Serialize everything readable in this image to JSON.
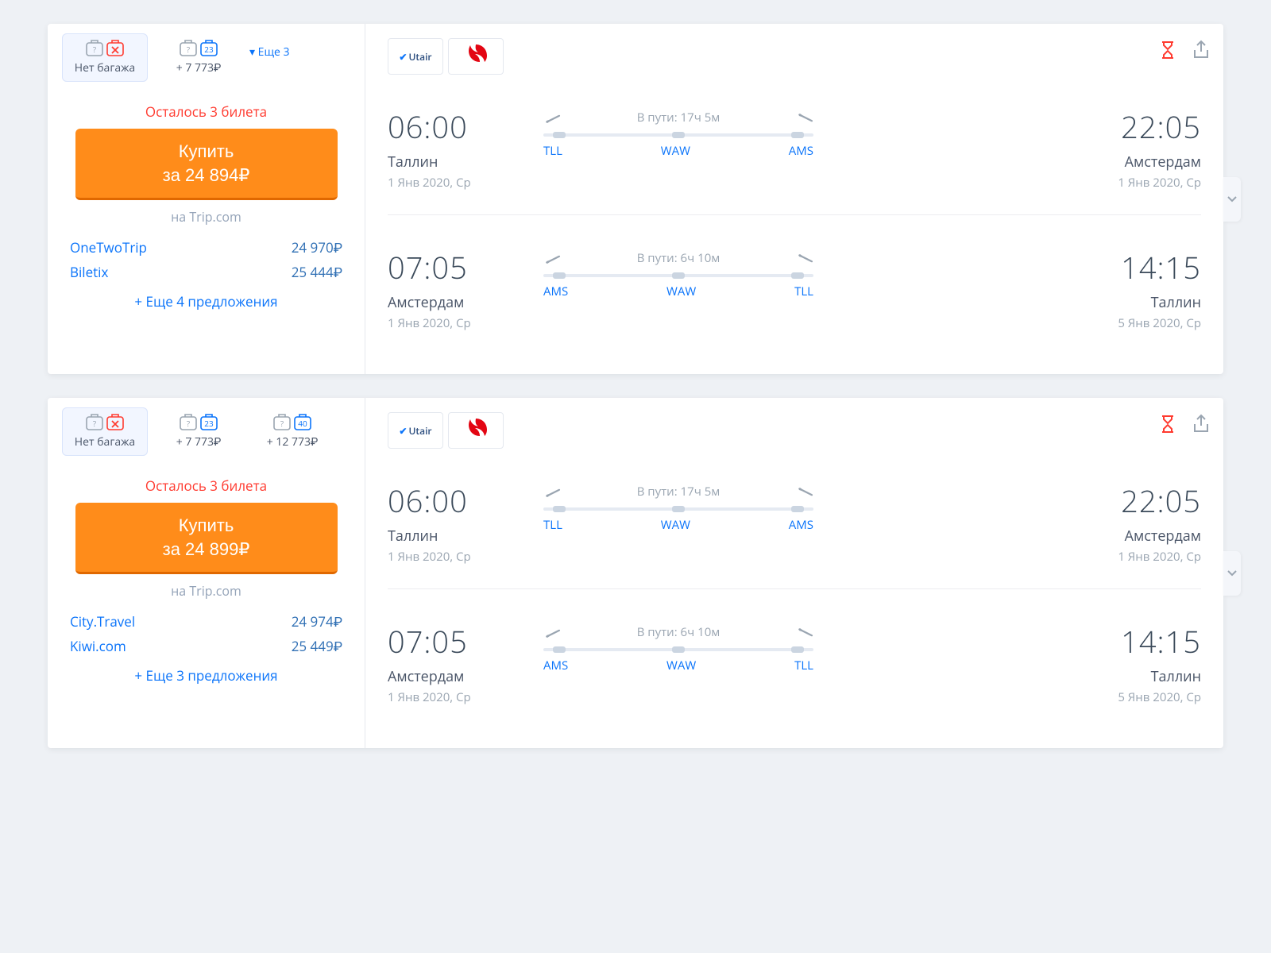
{
  "cards": [
    {
      "baggage": {
        "tabs": [
          {
            "label": "Нет багажа",
            "variant": "none"
          },
          {
            "label": "+ 7 773₽",
            "variant": "kg",
            "kg": "23"
          }
        ],
        "more": "▾ Еще 3"
      },
      "tickets_left": "Осталось 3 билета",
      "buy": {
        "line1": "Купить",
        "line2": "за 24 894₽"
      },
      "buy_on": "на Trip.com",
      "alts": [
        {
          "name": "OneTwoTrip",
          "price": "24 970₽"
        },
        {
          "name": "Biletix",
          "price": "25 444₽"
        }
      ],
      "more_offers": "+ Еще 4 предложения",
      "airlines": [
        "Utair",
        "red-bird"
      ],
      "segments": [
        {
          "dep_time": "06:00",
          "dep_city": "Таллин",
          "dep_date": "1 Янв 2020, Ср",
          "duration": "В пути: 17ч 5м",
          "codes": [
            "TLL",
            "WAW",
            "AMS"
          ],
          "arr_time": "22:05",
          "arr_city": "Амстердам",
          "arr_date": "1 Янв 2020, Ср"
        },
        {
          "dep_time": "07:05",
          "dep_city": "Амстердам",
          "dep_date": "1 Янв 2020, Ср",
          "duration": "В пути: 6ч 10м",
          "codes": [
            "AMS",
            "WAW",
            "TLL"
          ],
          "arr_time": "14:15",
          "arr_city": "Таллин",
          "arr_date": "5 Янв 2020, Ср"
        }
      ]
    },
    {
      "baggage": {
        "tabs": [
          {
            "label": "Нет багажа",
            "variant": "none"
          },
          {
            "label": "+ 7 773₽",
            "variant": "kg",
            "kg": "23"
          },
          {
            "label": "+ 12 773₽",
            "variant": "kg",
            "kg": "40"
          }
        ]
      },
      "tickets_left": "Осталось 3 билета",
      "buy": {
        "line1": "Купить",
        "line2": "за 24 899₽"
      },
      "buy_on": "на Trip.com",
      "alts": [
        {
          "name": "City.Travel",
          "price": "24 974₽"
        },
        {
          "name": "Kiwi.com",
          "price": "25 449₽"
        }
      ],
      "more_offers": "+ Еще 3 предложения",
      "airlines": [
        "Utair",
        "red-bird"
      ],
      "segments": [
        {
          "dep_time": "06:00",
          "dep_city": "Таллин",
          "dep_date": "1 Янв 2020, Ср",
          "duration": "В пути: 17ч 5м",
          "codes": [
            "TLL",
            "WAW",
            "AMS"
          ],
          "arr_time": "22:05",
          "arr_city": "Амстердам",
          "arr_date": "1 Янв 2020, Ср"
        },
        {
          "dep_time": "07:05",
          "dep_city": "Амстердам",
          "dep_date": "1 Янв 2020, Ср",
          "duration": "В пути: 6ч 10м",
          "codes": [
            "AMS",
            "WAW",
            "TLL"
          ],
          "arr_time": "14:15",
          "arr_city": "Таллин",
          "arr_date": "5 Янв 2020, Ср"
        }
      ]
    }
  ]
}
